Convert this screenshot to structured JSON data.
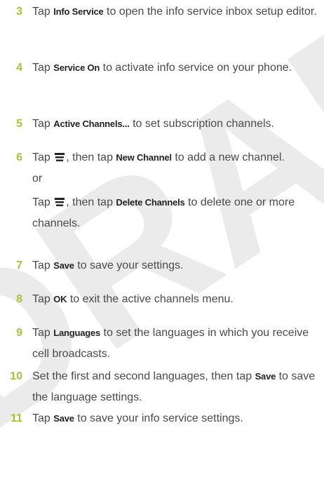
{
  "watermark": {
    "text": "DRAFT"
  },
  "steps": [
    {
      "num": "3",
      "pre": "Tap",
      "key": "Info Service",
      "rest": "to open the info service inbox setup editor."
    },
    {
      "num": "4",
      "pre": "Tap",
      "key": "Service On",
      "rest": "to activate info service on your phone."
    },
    {
      "num": "5",
      "pre": "Tap",
      "key": "Active Channels...",
      "rest": "to set subscription channels."
    },
    {
      "num": "6",
      "a_pre": "Tap",
      "a_mid": ", then tap",
      "a_key": "New Channel",
      "a_rest": "to add a new channel.",
      "or": "or",
      "b_pre": "Tap",
      "b_mid": ", then tap",
      "b_key": "Delete Channels",
      "b_rest": "to delete one or more channels.",
      "icon": "menu-icon"
    },
    {
      "num": "7",
      "pre": "Tap",
      "key": "Save",
      "rest": "to save your settings."
    },
    {
      "num": "8",
      "pre": "Tap",
      "key": "OK",
      "rest": "to exit the active channels menu."
    },
    {
      "num": "9",
      "pre": "Tap",
      "key": "Languages",
      "rest": "to set the languages in which you receive cell broadcasts."
    },
    {
      "num": "10",
      "pre": "Set the first and second languages, then tap",
      "key": "Save",
      "rest": "to save the language settings."
    },
    {
      "num": "11",
      "pre": "Tap",
      "key": "Save",
      "rest": "to save your info service settings."
    }
  ],
  "colors": {
    "step_number": "#a9c23a",
    "text": "#4a4a4a",
    "watermark": "#e6e6e6"
  }
}
